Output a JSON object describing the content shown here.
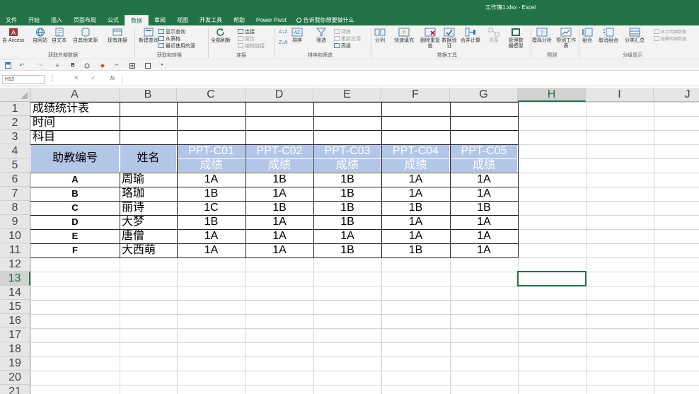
{
  "window": {
    "title": "工作簿1.xlsx - Excel"
  },
  "ribbon_tabs": [
    "文件",
    "开始",
    "插入",
    "页面布局",
    "公式",
    "数据",
    "审阅",
    "视图",
    "开发工具",
    "帮助",
    "Power Pivot"
  ],
  "active_tab": "数据",
  "tell_me": "告诉我你想要做什么",
  "ribbon": {
    "get_external_data": {
      "group_label": "获取外部数据",
      "access": "自 Access",
      "web": "自网站",
      "text": "自文本",
      "other": "自其他来源",
      "existing": "现有连接"
    },
    "get_transform": {
      "group_label": "获取和转换",
      "new_query": "新建查询",
      "show_queries": "显示查询",
      "from_table": "从表格",
      "recent_sources": "最近使用的源"
    },
    "connections": {
      "group_label": "连接",
      "refresh_all": "全部刷新",
      "connections": "连接",
      "properties": "属性",
      "edit_links": "编辑链接"
    },
    "sort_filter": {
      "group_label": "排序和筛选",
      "sort": "排序",
      "filter": "筛选",
      "clear": "清除",
      "reapply": "重新应用",
      "advanced": "高级"
    },
    "data_tools": {
      "group_label": "数据工具",
      "text_to_columns": "分列",
      "flash_fill": "快速填充",
      "remove_duplicates": "删除重复值",
      "validation": "数据验证",
      "consolidate": "合并计算",
      "relationships": "关系",
      "data_model": "管理数据模型"
    },
    "forecast": {
      "group_label": "预测",
      "what_if": "模拟分析",
      "forecast_sheet": "预测工作表"
    },
    "outline": {
      "group_label": "分级显示",
      "group": "组合",
      "ungroup": "取消组合",
      "subtotal": "分类汇总",
      "show_detail": "显示明细数据",
      "hide_detail": "隐藏明细数据"
    }
  },
  "formula_bar": {
    "name_box": "H13",
    "fx": "fx",
    "formula": ""
  },
  "columns": [
    "A",
    "B",
    "C",
    "D",
    "E",
    "F",
    "G",
    "H",
    "I",
    "J"
  ],
  "rows": [
    "1",
    "2",
    "3",
    "4",
    "5",
    "6",
    "7",
    "8",
    "9",
    "10",
    "11",
    "12",
    "13",
    "14",
    "15",
    "16",
    "17",
    "18",
    "19",
    "20",
    "21"
  ],
  "selected_cell": "H13",
  "sheet": {
    "A1": "成绩统计表",
    "A2": "时间",
    "A3": "科目",
    "header_id": "助教编号",
    "header_name": "姓名",
    "courses": [
      "PPT-C01",
      "PPT-C02",
      "PPT-C03",
      "PPT-C04",
      "PPT-C05"
    ],
    "grade_label": "成绩",
    "records": [
      {
        "id": "A",
        "name": "周瑜",
        "grades": [
          "1A",
          "1B",
          "1B",
          "1A",
          "1A"
        ]
      },
      {
        "id": "B",
        "name": "珞珈",
        "grades": [
          "1B",
          "1A",
          "1B",
          "1A",
          "1A"
        ]
      },
      {
        "id": "C",
        "name": "丽诗",
        "grades": [
          "1C",
          "1B",
          "1B",
          "1B",
          "1B"
        ]
      },
      {
        "id": "D",
        "name": "大梦",
        "grades": [
          "1B",
          "1A",
          "1B",
          "1A",
          "1A"
        ]
      },
      {
        "id": "E",
        "name": "唐僧",
        "grades": [
          "1A",
          "1A",
          "1A",
          "1A",
          "1A"
        ]
      },
      {
        "id": "F",
        "name": "大西萌",
        "grades": [
          "1A",
          "1A",
          "1B",
          "1B",
          "1A"
        ]
      }
    ]
  },
  "colors": {
    "excel_green": "#217346",
    "header_fill": "#b4c6e7",
    "header_text": "#ffffff",
    "gridline": "#d4d4d4",
    "table_border": "#222222"
  }
}
